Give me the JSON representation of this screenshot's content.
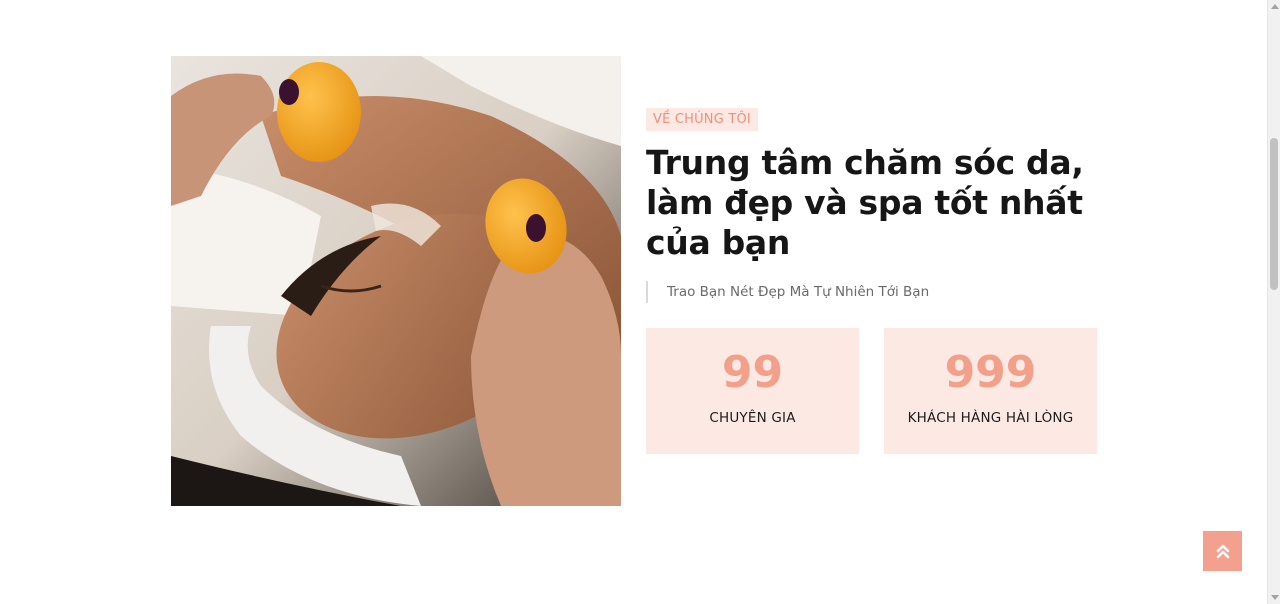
{
  "about": {
    "tag": "VỀ CHÚNG TÔI",
    "title": "Trung tâm chăm sóc da, làm đẹp và spa tốt nhất của bạn",
    "subtitle": "Trao Bạn Nét Đẹp Mà Tự Nhiên Tới Bạn",
    "stats": [
      {
        "value": "99",
        "label": "CHUYÊN GIA"
      },
      {
        "value": "999",
        "label": "KHÁCH HÀNG HÀI LÒNG"
      }
    ]
  },
  "colors": {
    "accent": "#f2a089",
    "tag_bg": "#fde9e3",
    "button": "#f4a08f"
  },
  "icons": {
    "scroll_top": "double-chevron-up-icon"
  }
}
